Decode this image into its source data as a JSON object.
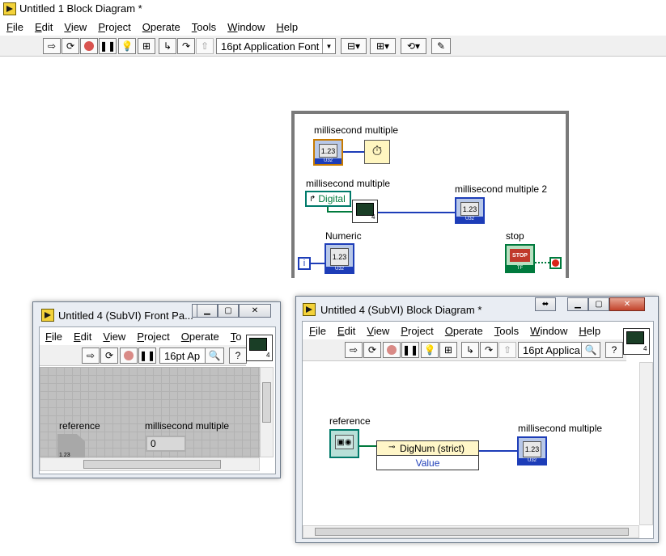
{
  "main_window": {
    "title": "Untitled 1 Block Diagram *",
    "menu": [
      "File",
      "Edit",
      "View",
      "Project",
      "Operate",
      "Tools",
      "Window",
      "Help"
    ],
    "font_selector": "16pt Application Font"
  },
  "diagram": {
    "labels": {
      "ms_multiple_top": "millisecond multiple",
      "ms_multiple_mid": "millisecond multiple",
      "ms_multiple_2": "millisecond multiple 2",
      "numeric": "Numeric",
      "stop": "stop"
    },
    "digital_property": "Digital",
    "terminal_value": "1.23",
    "terminal_type": "U32",
    "subvi_number": "4",
    "stop_text": "STOP",
    "bool_type": "TF",
    "iteration": "i"
  },
  "front_panel": {
    "title": "Untitled 4 (SubVI) Front Pa...",
    "menu": [
      "File",
      "Edit",
      "View",
      "Project",
      "Operate",
      "To"
    ],
    "font_selector": "16pt Ap",
    "reference_label": "reference",
    "ms_label": "millisecond multiple",
    "ms_value": "0",
    "ref_icon_text": "1.23",
    "subvi_number": "4"
  },
  "subvi_diagram": {
    "title": "Untitled 4 (SubVI) Block Diagram *",
    "menu": [
      "File",
      "Edit",
      "View",
      "Project",
      "Operate",
      "Tools",
      "Window",
      "Help"
    ],
    "font_selector": "16pt Applica",
    "reference_label": "reference",
    "ms_label": "millisecond multiple",
    "property_node_class": "DigNum (strict)",
    "property_node_prop": "Value",
    "terminal_value": "1.23",
    "terminal_type": "U32",
    "subvi_number": "4"
  },
  "colors": {
    "wire_numeric": "#1d3db8",
    "wire_boolean": "#007a3d",
    "property_node_header": "#fff6c8",
    "stop_button": "#c0392b",
    "loop_border": "#7a7a7a"
  }
}
